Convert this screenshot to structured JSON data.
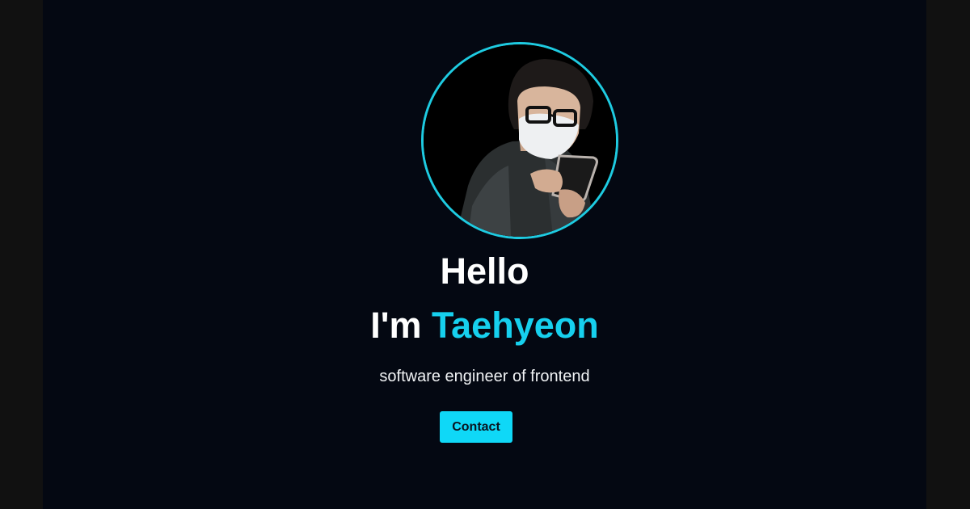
{
  "hero": {
    "greeting": "Hello",
    "intro_prefix": "I'm ",
    "name": "Taehyeon",
    "tagline": "software engineer of frontend",
    "contact_label": "Contact"
  },
  "colors": {
    "background": "#040812",
    "accent": "#16d0ee",
    "button": "#0fd8f7",
    "text": "#ffffff"
  },
  "icons": {
    "avatar": "profile-photo"
  }
}
